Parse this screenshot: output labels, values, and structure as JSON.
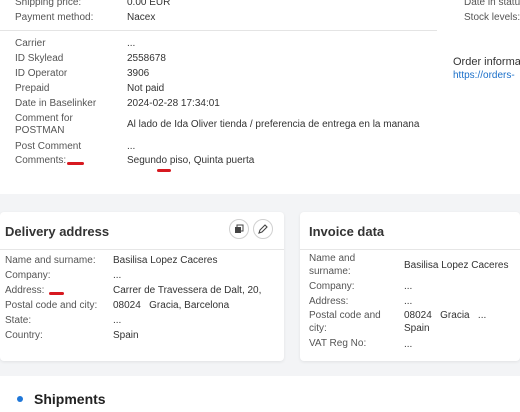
{
  "summary": {
    "shipping_price_label": "Shipping price:",
    "shipping_price_value": "0.00 EUR",
    "payment_method_label": "Payment method:",
    "payment_method_value": "Nacex"
  },
  "details": [
    {
      "label": "Carrier",
      "value": "..."
    },
    {
      "label": "ID Skylead",
      "value": "2558678"
    },
    {
      "label": "ID Operator",
      "value": "3906"
    },
    {
      "label": "Prepaid",
      "value": "Not paid"
    },
    {
      "label": "Date in Baselinker",
      "value": "2024-02-28 17:34:01"
    },
    {
      "label": "Comment for POSTMAN",
      "value": "Al lado de Ida Oliver tienda / preferencia de entrega en la manana"
    },
    {
      "label": "Post Comment",
      "value": "..."
    },
    {
      "label": "Comments:",
      "value": "Segundo piso, Quinta puerta"
    }
  ],
  "side": {
    "date_in_status": "Date in statu",
    "stock_levels": "Stock levels:",
    "order_info_title": "Order informa",
    "order_info_link": "https://orders-"
  },
  "delivery": {
    "title": "Delivery address",
    "fields": [
      {
        "label": "Name and surname:",
        "value": "Basilisa Lopez Caceres"
      },
      {
        "label": "Company:",
        "value": "..."
      },
      {
        "label": "Address:",
        "value": "Carrer de Travessera de Dalt, 20,"
      },
      {
        "label": "Postal code and city:",
        "value": "08024   Gracia, Barcelona"
      },
      {
        "label": "State:",
        "value": "..."
      },
      {
        "label": "Country:",
        "value": "Spain"
      }
    ]
  },
  "invoice": {
    "title": "Invoice data",
    "name_label_1": "Name and",
    "name_label_2": "surname:",
    "name_value": "Basilisa Lopez Caceres",
    "company_label": "Company:",
    "company_value": "...",
    "address_label": "Address:",
    "address_value": "...",
    "postal_label_1": "Postal code and",
    "postal_label_2": "city:",
    "postal_value_1": "08024   Gracia   ...",
    "postal_value_2": "Spain",
    "vat_label": "VAT Reg No:",
    "vat_value": "..."
  },
  "shipments": {
    "title": "Shipments"
  },
  "colors": {
    "accent": "#1f77d8",
    "highlight": "#d71920"
  }
}
